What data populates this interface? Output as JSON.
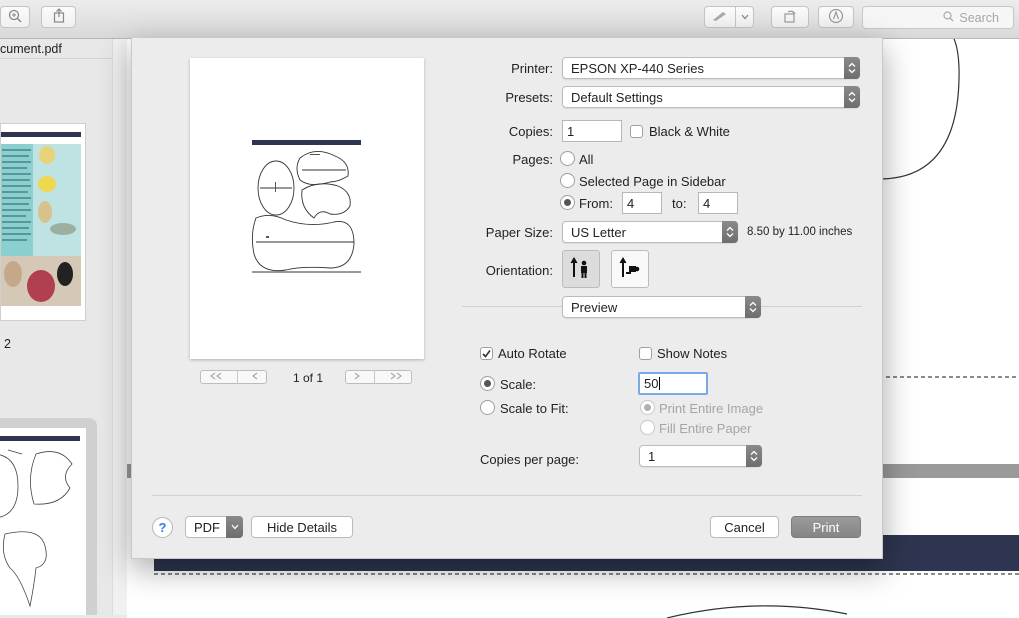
{
  "background": {
    "sidebar": {
      "filename": "cument.pdf",
      "page_label": "2"
    },
    "toolbar": {
      "search_placeholder": "Search"
    }
  },
  "dialog": {
    "printer": {
      "label": "Printer:",
      "value": "EPSON XP-440 Series"
    },
    "presets": {
      "label": "Presets:",
      "value": "Default Settings"
    },
    "copies": {
      "label": "Copies:",
      "value": "1"
    },
    "black_white": {
      "label": "Black & White",
      "checked": false
    },
    "pages": {
      "label": "Pages:",
      "all": "All",
      "selected": "Selected Page in Sidebar",
      "from_label": "From:",
      "from_value": "4",
      "to_label": "to:",
      "to_value": "4",
      "selected_option": "from"
    },
    "paper_size": {
      "label": "Paper Size:",
      "value": "US Letter",
      "dims": "8.50 by 11.00 inches"
    },
    "orientation": {
      "label": "Orientation:",
      "selected": "portrait"
    },
    "app_menu": {
      "value": "Preview"
    },
    "auto_rotate": {
      "label": "Auto Rotate",
      "checked": true
    },
    "show_notes": {
      "label": "Show Notes",
      "checked": false
    },
    "scale": {
      "label": "Scale:",
      "value": "50",
      "selected": true
    },
    "scale_to_fit": {
      "label": "Scale to Fit:",
      "print_entire": "Print Entire Image",
      "fill_entire": "Fill Entire Paper"
    },
    "copies_per_page": {
      "label": "Copies per page:",
      "value": "1"
    },
    "preview_pager": {
      "text": "1 of 1"
    },
    "buttons": {
      "help": "?",
      "pdf": "PDF",
      "hide_details": "Hide Details",
      "cancel": "Cancel",
      "print": "Print"
    },
    "colors": {
      "accent": "#3b7be0",
      "print_button": "#8d8d8d"
    }
  }
}
